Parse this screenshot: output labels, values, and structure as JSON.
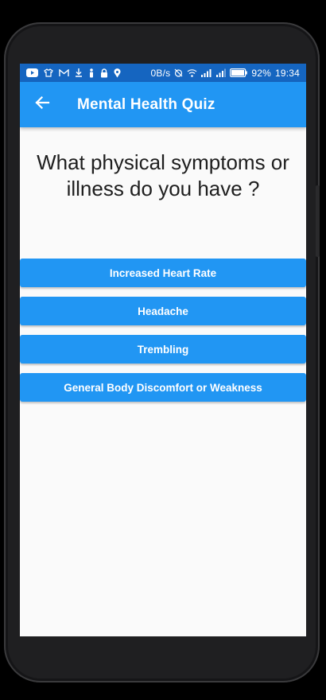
{
  "status_bar": {
    "data_rate": "0B/s",
    "battery": "92%",
    "time": "19:34",
    "icons": [
      "youtube-icon",
      "shirt-icon",
      "gmail-icon",
      "download-icon",
      "person-icon",
      "lock-icon",
      "location-icon",
      "alarm-off-icon",
      "wifi-icon",
      "signal-icon",
      "signal-icon",
      "battery-icon"
    ]
  },
  "app_bar": {
    "title": "Mental Health Quiz",
    "back_icon": "arrow-back-icon"
  },
  "quiz": {
    "question": "What physical symptoms or illness do you have ?",
    "answers": [
      "Increased Heart Rate",
      "Headache",
      "Trembling",
      "General Body Discomfort or Weakness"
    ]
  },
  "colors": {
    "status_bar": "#1565c0",
    "app_bar": "#2196f3",
    "button": "#2196f3",
    "background": "#fafafa"
  }
}
